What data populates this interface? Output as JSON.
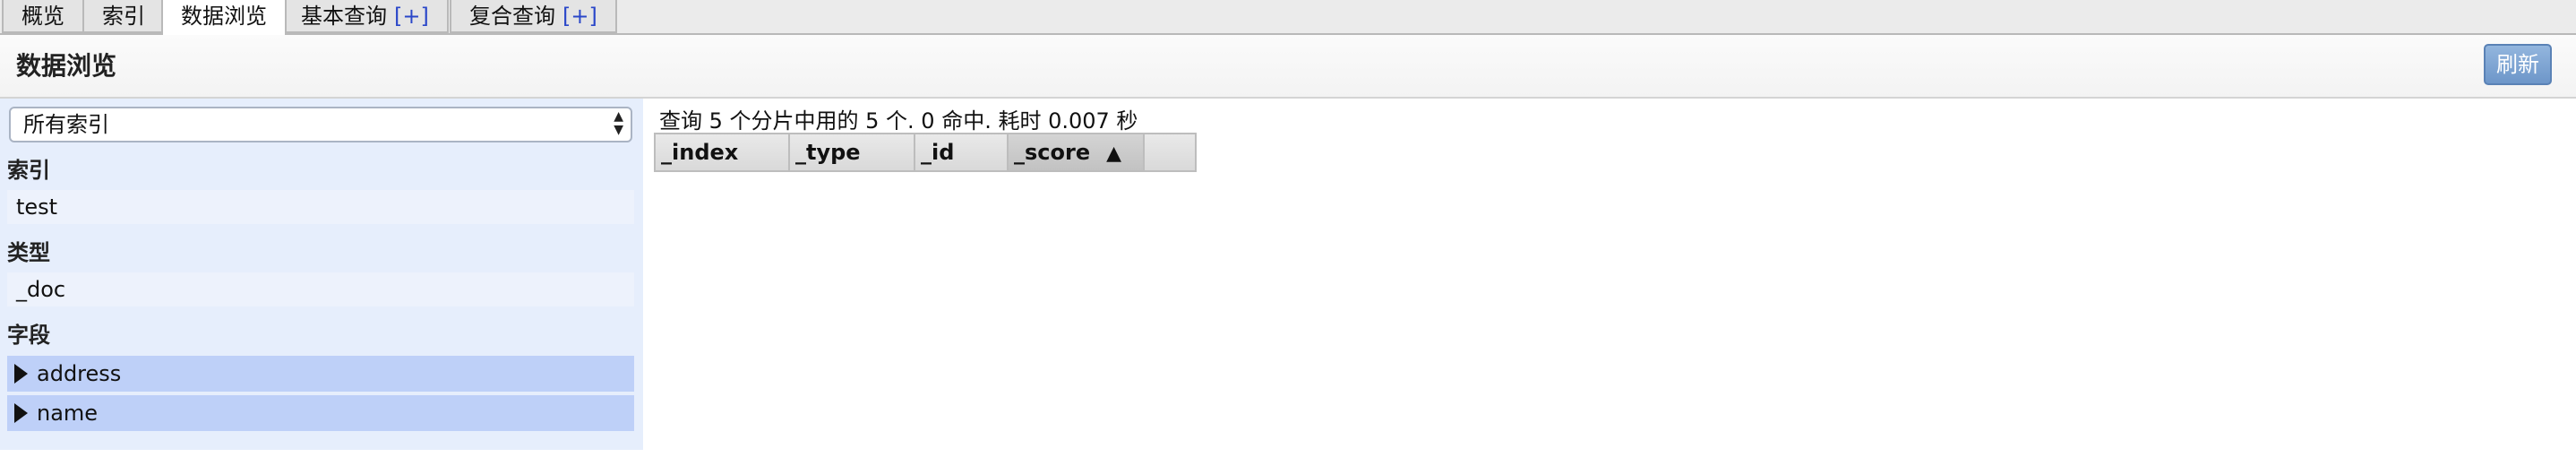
{
  "tabs": [
    {
      "label": "概览"
    },
    {
      "label": "索引"
    },
    {
      "label": "数据浏览"
    },
    {
      "label": "基本查询",
      "plus": "[+]"
    },
    {
      "label": "复合查询",
      "plus": "[+]"
    }
  ],
  "header": {
    "title": "数据浏览",
    "refresh_label": "刷新"
  },
  "sidebar": {
    "index_select": {
      "value": "所有索引"
    },
    "sections": {
      "index": {
        "label": "索引",
        "items": [
          "test"
        ]
      },
      "type": {
        "label": "类型",
        "items": [
          "_doc"
        ]
      },
      "fields": {
        "label": "字段",
        "items": [
          "address",
          "name"
        ]
      }
    }
  },
  "results": {
    "status": "查询 5 个分片中用的 5 个. 0 命中. 耗时 0.007 秒",
    "columns": [
      "_index",
      "_type",
      "_id",
      "_score"
    ],
    "sort_indicator": "▲"
  },
  "colors": {
    "accent": "#6d96c9",
    "sidebar_bg": "#e6eefc",
    "field_bg": "#bed0f8"
  }
}
